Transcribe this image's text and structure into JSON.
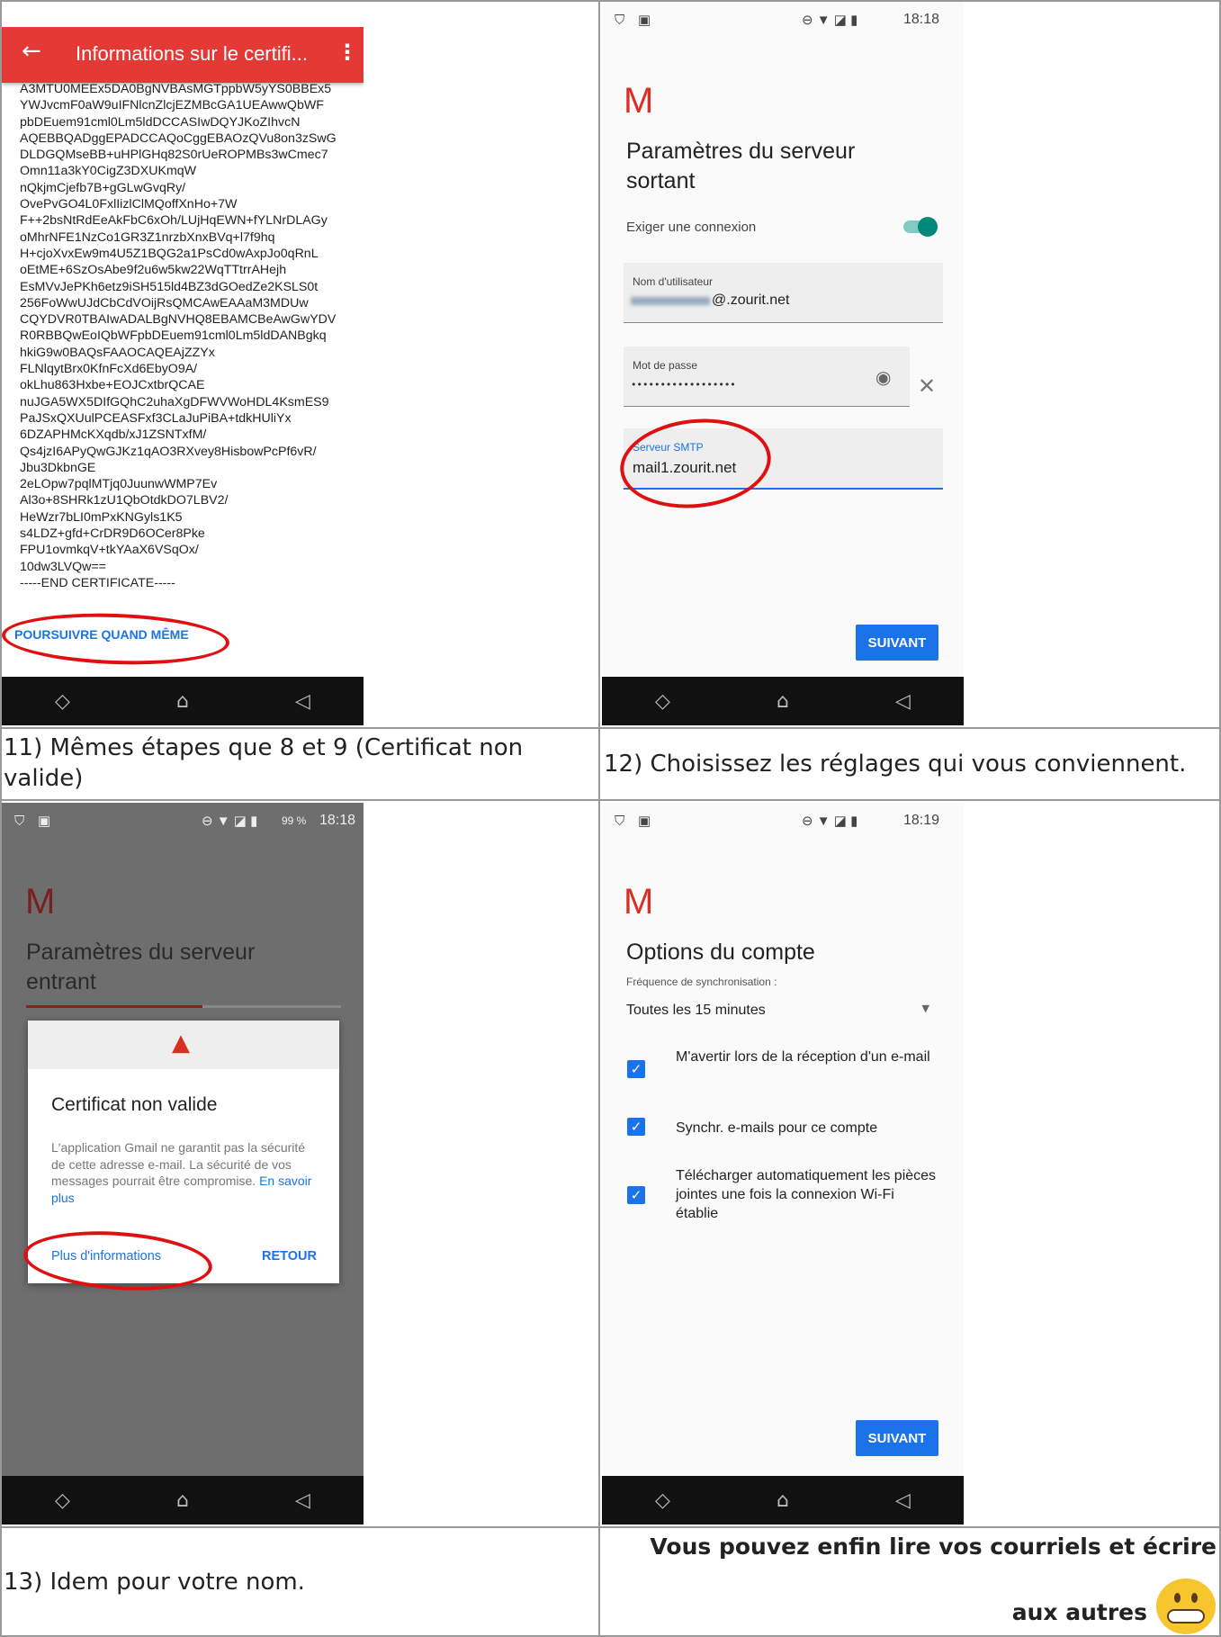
{
  "panel11": {
    "app_bar": {
      "title": "Informations sur le certifi...",
      "back": "←",
      "menu": "⋮"
    },
    "certificate_lines": [
      "A3MTU0MEEx5DA0BgNVBAsMGTppbW5yYS0BBEx5",
      "YWJvcmF0aW9uIFNlcnZlcjEZMBcGA1UEAwwQbWF",
      "pbDEuem91cml0Lm5ldDCCASIwDQYJKoZIhvcN",
      "AQEBBQADggEPADCCAQoCggEBAOzQVu8on3zSwG",
      "DLDGQMseBB+uHPlGHq82S0rUeROPMBs3wCmec7",
      "Omn11a3kY0CigZ3DXUKmqW",
      "nQkjmCjefb7B+gGLwGvqRy/",
      "OvePvGO4L0FxlIizlClMQoffXnHo+7W",
      "F++2bsNtRdEeAkFbC6xOh/LUjHqEWN+fYLNrDLAGy",
      "oMhrNFE1NzCo1GR3Z1nrzbXnxBVq+l7f9hq",
      "H+cjoXvxEw9m4U5Z1BQG2a1PsCd0wAxpJo0qRnL",
      "oEtME+6SzOsAbe9f2u6w5kw22WqTTtrrAHejh",
      "EsMVvJePKh6etz9iSH515ld4BZ3dGOedZe2KSLS0t",
      "256FoWwUJdCbCdVOijRsQMCAwEAAaM3MDUw",
      "CQYDVR0TBAIwADALBgNVHQ8EBAMCBeAwGwYDV",
      "R0RBBQwEoIQbWFpbDEuem91cml0Lm5ldDANBgkq",
      "hkiG9w0BAQsFAAOCAQEAjZZYx",
      "FLNlqytBrx0KfnFcXd6EbyO9A/",
      "okLhu863Hxbe+EOJCxtbrQCAE",
      "nuJGA5WX5DIfGQhC2uhaXgDFWVWoHDL4KsmES9",
      "PaJSxQXUulPCEASFxf3CLaJuPiBA+tdkHUliYx",
      "6DZAPHMcKXqdb/xJ1ZSNTxfM/",
      "Qs4jzI6APyQwGJKz1qAO3RXvey8HisbowPcPf6vR/",
      "Jbu3DkbnGE",
      "2eLOpw7pqlMTjq0JuunwWMP7Ev",
      "Al3o+8SHRk1zU1QbOtdkDO7LBV2/",
      "HeWzr7bLI0mPxKNGyls1K5",
      "s4LDZ+gfd+CrDR9D6OCer8Pke",
      "FPU1ovmkqV+tkYAaX6VSqOx/",
      "10dw3LVQw==",
      "-----END CERTIFICATE-----"
    ],
    "continue_link": "POURSUIVRE QUAND MÊME"
  },
  "panel12": {
    "status": {
      "time": "18:18"
    },
    "title_line1": "Paramètres du serveur",
    "title_line2": "sortant",
    "require_login_label": "Exiger une connexion",
    "username_label": "Nom d'utilisateur",
    "username_value": "@.zourit.net",
    "password_label": "Mot de passe",
    "password_value": "••••••••••••••••••",
    "smtp_label": "Serveur SMTP",
    "smtp_value": "mail1.zourit.net",
    "next_button": "SUIVANT"
  },
  "captions": {
    "c11": "11) Mêmes étapes que 8 et 9 (Certificat non valide)",
    "c12": "12) Choisissez les réglages qui vous conviennent.",
    "c13": "13) Idem pour votre nom.",
    "final_line1": "Vous pouvez enfin lire vos courriels et écrire",
    "final_line2": "aux autres"
  },
  "panel13": {
    "status": {
      "time": "18:18",
      "battery": "99 %"
    },
    "title_line1": "Paramètres du serveur",
    "title_line2": "entrant",
    "dialog": {
      "heading": "Certificat non valide",
      "body": "L'application Gmail ne garantit pas la sécurité de cette adresse e-mail. La sécurité de vos messages pourrait être compromise.",
      "learn_more": "En savoir plus",
      "more_info": "Plus d'informations",
      "back": "RETOUR"
    }
  },
  "panel14": {
    "status": {
      "time": "18:19"
    },
    "title": "Options du compte",
    "sync_label": "Fréquence de synchronisation :",
    "sync_value": "Toutes les 15 minutes",
    "options": [
      "M'avertir lors de la réception d'un e-mail",
      "Synchr. e-mails pour ce compte",
      "Télécharger automatiquement les pièces jointes une fois la connexion Wi-Fi établie"
    ],
    "next_button": "SUIVANT"
  },
  "nav_icons": {
    "recent": "◇",
    "home": "⌂",
    "back": "◁"
  },
  "colors": {
    "gmail_red": "#d93025",
    "accent_blue": "#1a73e8",
    "app_bar_red": "#e53935",
    "toggle_teal": "#00897b"
  }
}
